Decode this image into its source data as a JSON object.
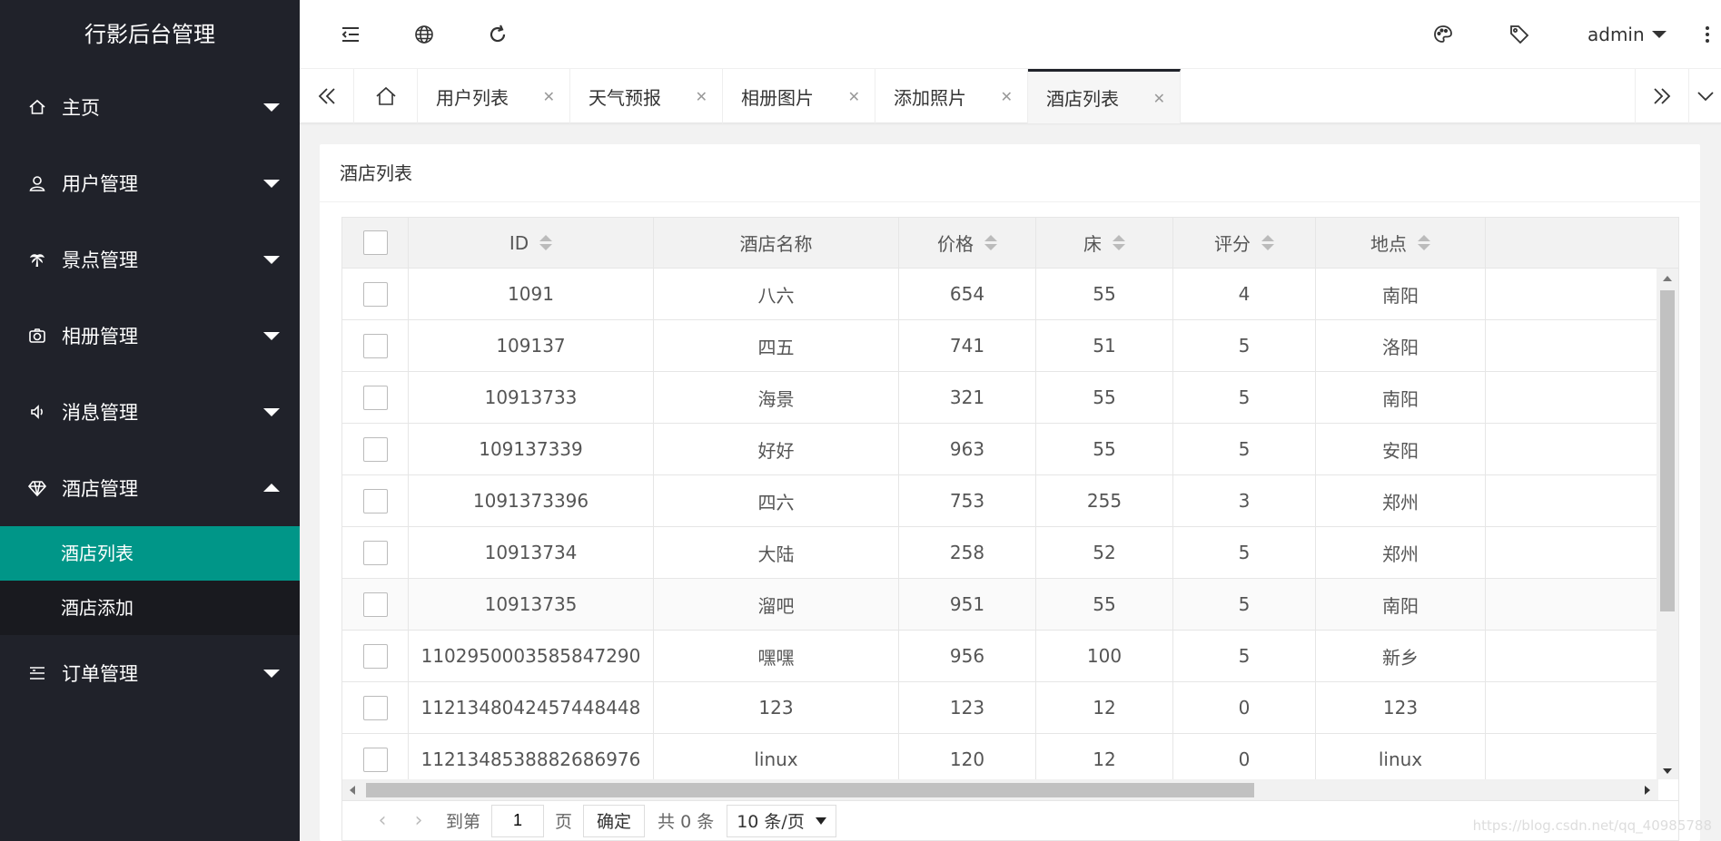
{
  "app": {
    "title": "行影后台管理"
  },
  "sidebar": {
    "items": [
      {
        "label": "主页",
        "icon": "home-icon"
      },
      {
        "label": "用户管理",
        "icon": "user-icon"
      },
      {
        "label": "景点管理",
        "icon": "palm-tree-icon"
      },
      {
        "label": "相册管理",
        "icon": "camera-icon"
      },
      {
        "label": "消息管理",
        "icon": "speaker-icon"
      },
      {
        "label": "酒店管理",
        "icon": "diamond-icon",
        "expanded": true
      },
      {
        "label": "订单管理",
        "icon": "list-icon"
      }
    ],
    "hotel_sub": [
      {
        "label": "酒店列表",
        "active": true
      },
      {
        "label": "酒店添加"
      }
    ]
  },
  "header": {
    "user": "admin",
    "icons": [
      "menu-fold-icon",
      "globe-icon",
      "refresh-icon",
      "theme-icon",
      "tag-icon",
      "more-icon"
    ]
  },
  "tabs": [
    {
      "label": "用户列表"
    },
    {
      "label": "天气预报"
    },
    {
      "label": "相册图片"
    },
    {
      "label": "添加照片"
    },
    {
      "label": "酒店列表",
      "active": true
    }
  ],
  "card": {
    "title": "酒店列表"
  },
  "table": {
    "columns": [
      "ID",
      "酒店名称",
      "价格",
      "床",
      "评分",
      "地点"
    ],
    "rows": [
      [
        "1091",
        "八六",
        "654",
        "55",
        "4",
        "南阳"
      ],
      [
        "109137",
        "四五",
        "741",
        "51",
        "5",
        "洛阳"
      ],
      [
        "10913733",
        "海景",
        "321",
        "55",
        "5",
        "南阳"
      ],
      [
        "109137339",
        "好好",
        "963",
        "55",
        "5",
        "安阳"
      ],
      [
        "1091373396",
        "四六",
        "753",
        "255",
        "3",
        "郑州"
      ],
      [
        "10913734",
        "大陆",
        "258",
        "52",
        "5",
        "郑州"
      ],
      [
        "10913735",
        "溜吧",
        "951",
        "55",
        "5",
        "南阳"
      ],
      [
        "1102950003585847290",
        "嘿嘿",
        "956",
        "100",
        "5",
        "新乡"
      ],
      [
        "1121348042457448448",
        "123",
        "123",
        "12",
        "0",
        "123"
      ],
      [
        "1121348538882686976",
        "linux",
        "120",
        "12",
        "0",
        "linux"
      ]
    ]
  },
  "pager": {
    "goto_label": "到第",
    "page_value": "1",
    "page_unit": "页",
    "confirm": "确定",
    "total": "共 0 条",
    "page_size": "10 条/页"
  },
  "colors": {
    "sidebar": "#20222A",
    "accent": "#009688"
  },
  "watermark": "https://blog.csdn.net/qq_40985788"
}
